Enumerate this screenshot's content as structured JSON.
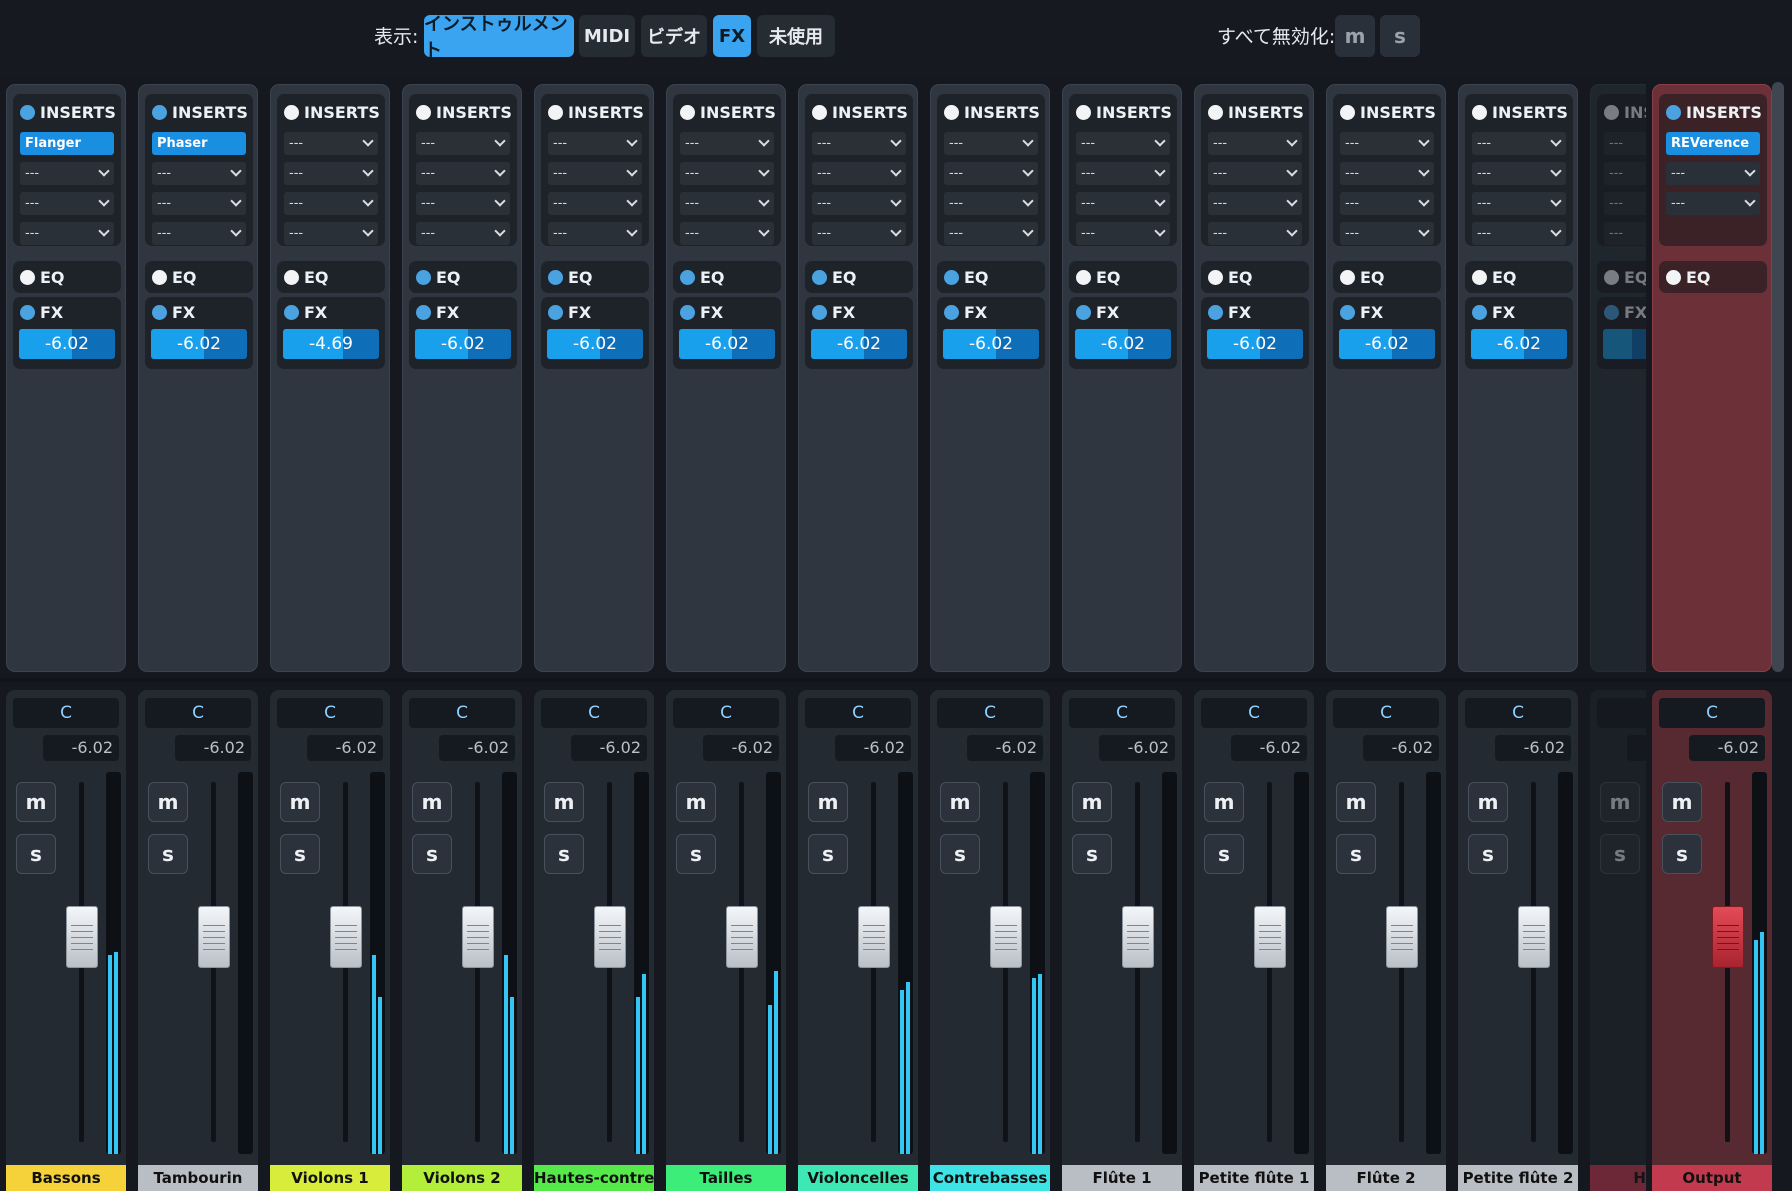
{
  "topbar": {
    "show_label": "表示:",
    "filters": [
      {
        "label": "インストゥルメント",
        "active": true
      },
      {
        "label": "MIDI",
        "active": false
      },
      {
        "label": "ビデオ",
        "active": false
      },
      {
        "label": "FX",
        "active": true
      },
      {
        "label": "未使用",
        "active": false
      }
    ],
    "disable_all_label": "すべて無効化:",
    "mute_all": "m",
    "solo_all": "s"
  },
  "labels": {
    "inserts": "INSERTS",
    "eq": "EQ",
    "fx": "FX",
    "empty_slot": "---",
    "mute": "m",
    "solo": "s"
  },
  "colors": {
    "accent": "#3aa4f0",
    "meter": "#35c5f5",
    "output_tint": "#6b3038"
  },
  "channels": [
    {
      "name": "Bassons",
      "color": "#f5d23a",
      "insert1": "Flanger",
      "fx_send": "-6.02",
      "fx_level": 0.55,
      "pan": "C",
      "volume": "-6.02",
      "fader_level": 0.62,
      "meter_l": 0.52,
      "meter_r": 0.53
    },
    {
      "name": "Tambourin",
      "color": "#b9bec4",
      "insert1": "Phaser",
      "fx_send": "-6.02",
      "fx_level": 0.55,
      "pan": "C",
      "volume": "-6.02",
      "fader_level": 0.62,
      "meter_l": 0.0,
      "meter_r": 0.0
    },
    {
      "name": "Violons 1",
      "color": "#d8ec3c",
      "insert1": "---",
      "fx_send": "-4.69",
      "fx_level": 0.62,
      "pan": "C",
      "volume": "-6.02",
      "fader_level": 0.62,
      "meter_l": 0.52,
      "meter_r": 0.41
    },
    {
      "name": "Violons 2",
      "color": "#b2ee3a",
      "insert1": "---",
      "fx_send": "-6.02",
      "fx_level": 0.55,
      "pan": "C",
      "volume": "-6.02",
      "fader_level": 0.62,
      "meter_l": 0.52,
      "meter_r": 0.41
    },
    {
      "name": "Hautes-contre",
      "color": "#55ea4a",
      "insert1": "---",
      "fx_send": "-6.02",
      "fx_level": 0.55,
      "pan": "C",
      "volume": "-6.02",
      "fader_level": 0.62,
      "meter_l": 0.41,
      "meter_r": 0.47
    },
    {
      "name": "Tailles",
      "color": "#3ded7a",
      "insert1": "---",
      "fx_send": "-6.02",
      "fx_level": 0.55,
      "pan": "C",
      "volume": "-6.02",
      "fader_level": 0.62,
      "meter_l": 0.39,
      "meter_r": 0.48
    },
    {
      "name": "Violoncelles",
      "color": "#3ee8b4",
      "insert1": "---",
      "fx_send": "-6.02",
      "fx_level": 0.55,
      "pan": "C",
      "volume": "-6.02",
      "fader_level": 0.62,
      "meter_l": 0.43,
      "meter_r": 0.45
    },
    {
      "name": "Contrebasses",
      "color": "#3ee3e6",
      "insert1": "---",
      "fx_send": "-6.02",
      "fx_level": 0.55,
      "pan": "C",
      "volume": "-6.02",
      "fader_level": 0.62,
      "meter_l": 0.46,
      "meter_r": 0.47
    },
    {
      "name": "Flûte 1",
      "color": "#b9bec4",
      "insert1": "---",
      "fx_send": "-6.02",
      "fx_level": 0.55,
      "pan": "C",
      "volume": "-6.02",
      "fader_level": 0.62,
      "meter_l": 0.0,
      "meter_r": 0.0
    },
    {
      "name": "Petite flûte 1",
      "color": "#b9bec4",
      "insert1": "---",
      "fx_send": "-6.02",
      "fx_level": 0.55,
      "pan": "C",
      "volume": "-6.02",
      "fader_level": 0.62,
      "meter_l": 0.0,
      "meter_r": 0.0
    },
    {
      "name": "Flûte 2",
      "color": "#b9bec4",
      "insert1": "---",
      "fx_send": "-6.02",
      "fx_level": 0.55,
      "pan": "C",
      "volume": "-6.02",
      "fader_level": 0.62,
      "meter_l": 0.0,
      "meter_r": 0.0
    },
    {
      "name": "Petite flûte 2",
      "color": "#b9bec4",
      "insert1": "---",
      "fx_send": "-6.02",
      "fx_level": 0.55,
      "pan": "C",
      "volume": "-6.02",
      "fader_level": 0.62,
      "meter_l": 0.0,
      "meter_r": 0.0
    },
    {
      "name": "Hau",
      "color": "#d63c52",
      "insert1": "---",
      "fx_send": "",
      "fx_level": 0.3,
      "pan": "",
      "volume": "",
      "fader_level": 0.62,
      "meter_l": 0.0,
      "meter_r": 0.0,
      "partial": true
    }
  ],
  "output": {
    "name": "Output",
    "color": "#c23a4d",
    "insert1": "REVerence",
    "pan": "C",
    "volume": "-6.02",
    "fader_level": 0.62,
    "meter_l": 0.56,
    "meter_r": 0.58
  }
}
